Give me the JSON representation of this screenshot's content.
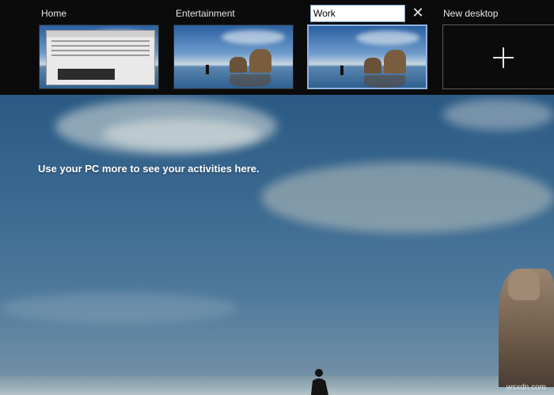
{
  "task_view": {
    "desktops": [
      {
        "label": "Home"
      },
      {
        "label": "Entertainment"
      },
      {
        "label": "",
        "rename_value": "Work",
        "selected": true
      }
    ],
    "new_desktop_label": "New desktop",
    "close_glyph": "✕",
    "plus_icon": "plus-icon",
    "close_icon": "close-icon"
  },
  "timeline": {
    "empty_message": "Use your PC more to see your activities here."
  },
  "watermark": "wsxdn.com",
  "colors": {
    "bar_background": "#0b0b0b",
    "selected_border": "#8fb4e0",
    "label_text": "#e6e6e6"
  }
}
